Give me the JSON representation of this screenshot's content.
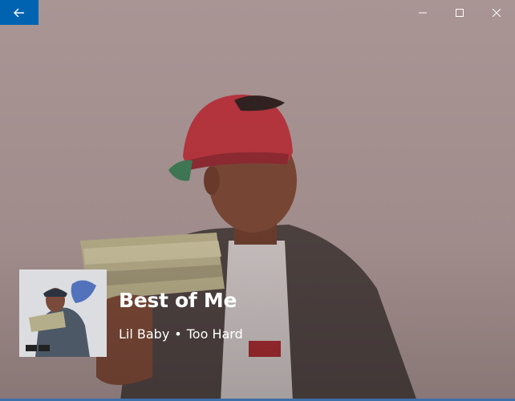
{
  "window": {
    "accent_color": "#0063b1",
    "background_color": "#a99594"
  },
  "titlebar": {
    "back_icon": "arrow-left-icon",
    "minimize_icon": "minimize-icon",
    "maximize_icon": "maximize-icon",
    "close_icon": "close-icon"
  },
  "now_playing": {
    "title": "Best of Me",
    "artist": "Lil Baby",
    "separator": "•",
    "album": "Too Hard"
  }
}
